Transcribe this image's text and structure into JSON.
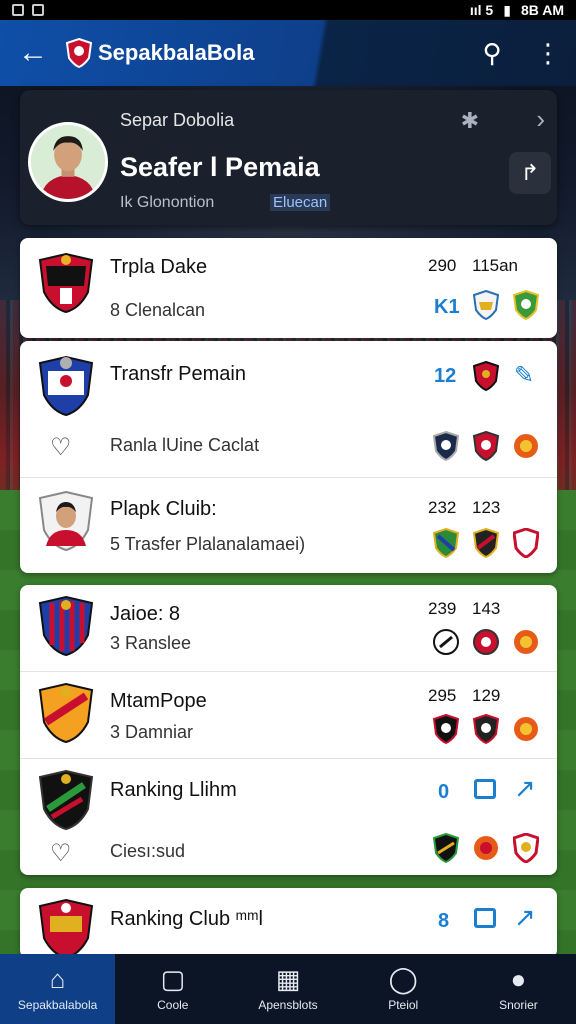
{
  "status_bar": {
    "signal": "ııl 5",
    "battery": "▮",
    "time": "8B AM"
  },
  "app_bar": {
    "title": "SepakbalaBola"
  },
  "profile": {
    "subtitle": "Separ Dobolia",
    "name": "Seafer l Pemaia",
    "meta": "Ik Glonontion",
    "tag": "Eluecan"
  },
  "list": [
    {
      "title": "Trpla Dake",
      "sub": "8 Clenalcan",
      "n1": "290",
      "n2": "115an",
      "blue": "K1"
    },
    {
      "title": "Transfr Pemain",
      "blue": "12"
    },
    {
      "title": "Ranla lUine Caclat"
    },
    {
      "title": "Plapk Cluib:",
      "sub": "5 Trasfer Plalanalamaei)",
      "n1": "232",
      "n2": "123"
    },
    {
      "title": "Jaioe: 8",
      "sub": "3 Ranslee",
      "n1": "239",
      "n2": "143"
    },
    {
      "title": "MtamPope",
      "sub": "3 Damniar",
      "n1": "295",
      "n2": "129"
    },
    {
      "title": "Ranking Llihm",
      "blue": "0"
    },
    {
      "title": "Ciesı:sud"
    },
    {
      "title": "Ranking Club ᵐᵐl",
      "blue": "8"
    }
  ],
  "bottom_nav": [
    {
      "label": "Sepakbalabola",
      "active": true
    },
    {
      "label": "Coole"
    },
    {
      "label": "Apensblots"
    },
    {
      "label": "Pteiol"
    },
    {
      "label": "Snorier"
    }
  ],
  "colors": {
    "primary": "#0f4fa8",
    "accent_blue": "#1a7fd1",
    "card": "#ffffff",
    "nav": "#0c1526"
  }
}
